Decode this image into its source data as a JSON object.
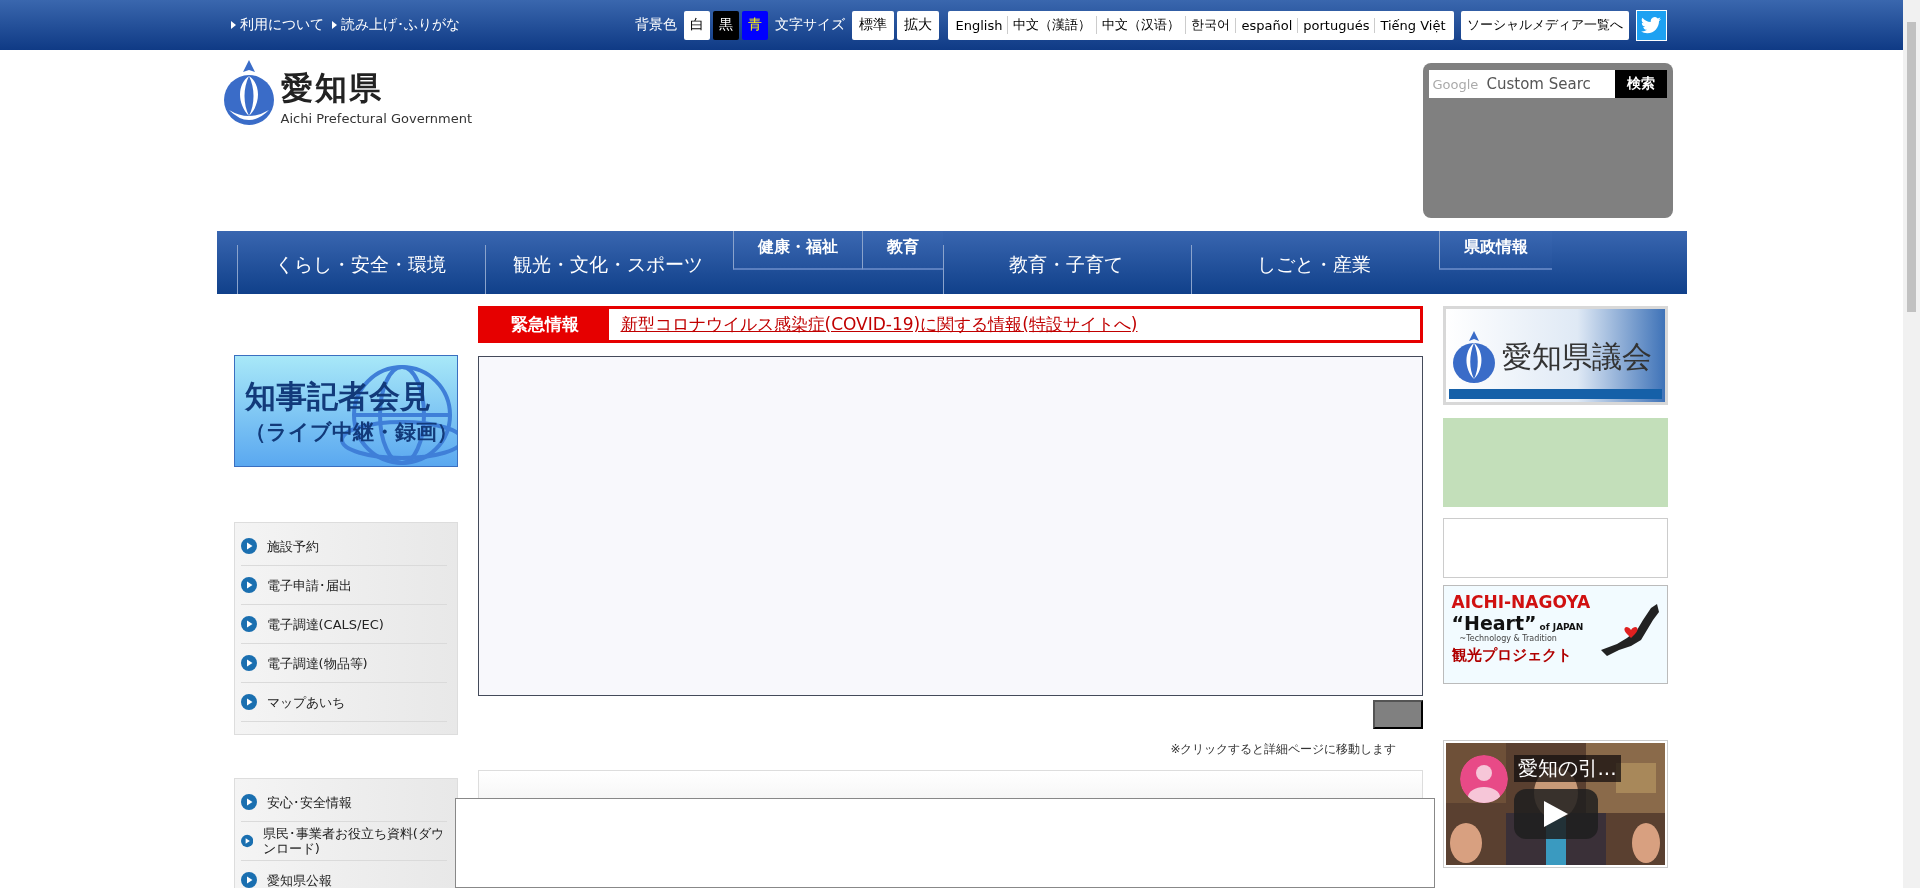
{
  "top_bar": {
    "links": [
      "利用について",
      "読み上げ･ふりがな"
    ],
    "background_label": "背景色",
    "background_options": [
      {
        "label": "白",
        "kind": "white"
      },
      {
        "label": "黒",
        "kind": "black"
      },
      {
        "label": "青",
        "kind": "blue"
      }
    ],
    "text_size_label": "文字サイズ",
    "text_size_options": [
      "標準",
      "拡大"
    ],
    "languages": [
      "English",
      "中文（漢語）",
      "中文（汉语）",
      "한국어",
      "español",
      "portugués",
      "Tiếng Việt"
    ],
    "social_button": "ソーシャルメディア一覧へ"
  },
  "header": {
    "logo_title": "愛知県",
    "logo_subtitle": "Aichi Prefectural Government",
    "search": {
      "brand": "Google",
      "placeholder": "Custom Searc",
      "button": "検索"
    }
  },
  "nav": [
    {
      "label": "くらし・安全・環境",
      "kind": "main"
    },
    {
      "label": "観光・文化・スポーツ",
      "kind": "main"
    },
    {
      "label": "健康・福祉",
      "kind": "tab"
    },
    {
      "label": "教育",
      "kind": "tab"
    },
    {
      "label": "教育・子育て",
      "kind": "main"
    },
    {
      "label": "しごと・産業",
      "kind": "main"
    },
    {
      "label": "県政情報",
      "kind": "tab"
    }
  ],
  "emergency": {
    "label": "緊急情報",
    "link": "新型コロナウイルス感染症(COVID-19)に関する情報(特設サイトへ)"
  },
  "left_banner": {
    "title": "知事記者会見",
    "subtitle": "（ライブ中継・録画）"
  },
  "left_menus": [
    [
      "施設予約",
      "電子申請･届出",
      "電子調達(CALS/EC)",
      "電子調達(物品等)",
      "マップあいち"
    ],
    [
      "安心･安全情報",
      "県民･事業者お役立ち資料(ダウンロード)",
      "愛知県公報"
    ]
  ],
  "slideshow_note": "※クリックすると詳細ページに移動します",
  "right_banners": [
    {
      "kind": "assembly",
      "text": "愛知県議会"
    },
    {
      "kind": "green"
    },
    {
      "kind": "empty"
    },
    {
      "kind": "tourism",
      "title": "AICHI-NAGOYA",
      "heart": "“Heart”",
      "of": "of JAPAN",
      "tagline": "~Technology & Tradition",
      "project": "観光プロジェクト"
    },
    {
      "kind": "video",
      "title": "愛知の引..."
    }
  ]
}
